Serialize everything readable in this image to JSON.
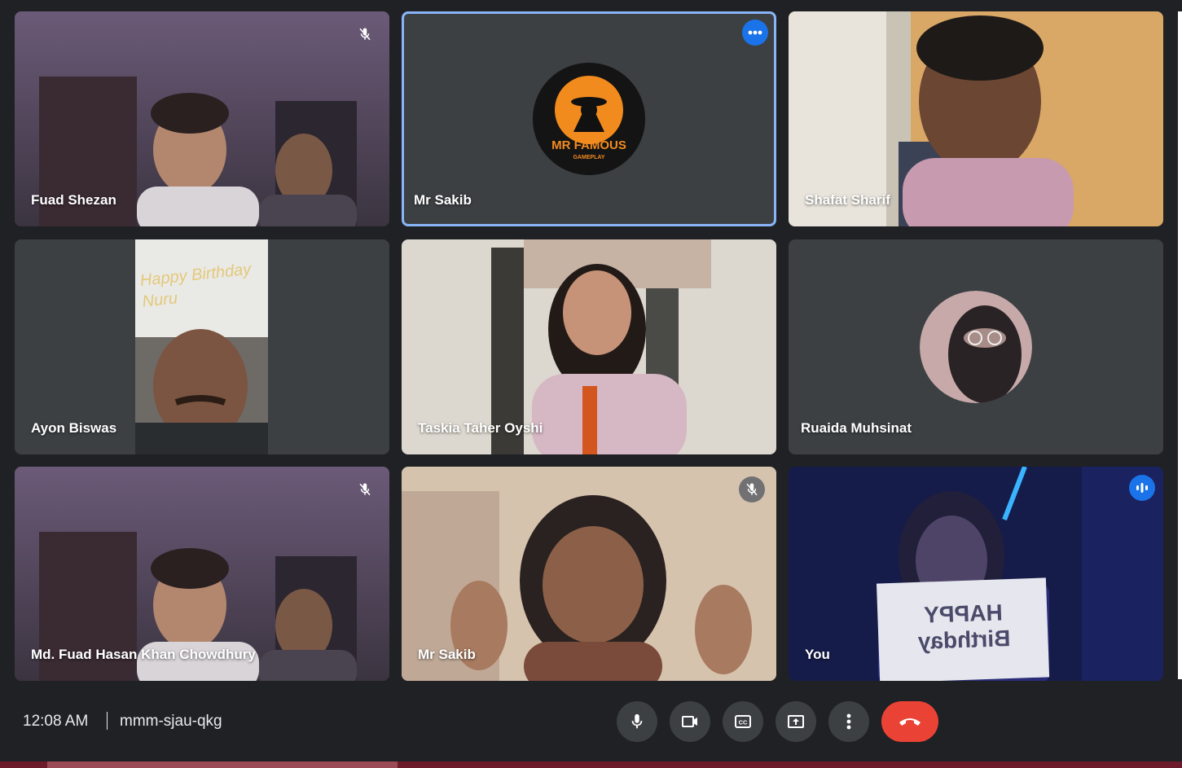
{
  "participants": [
    {
      "name": "Fuad Shezan",
      "muted": true
    },
    {
      "name": "Mr Sakib",
      "avatar_text": "MR FAMOUS",
      "avatar_subtext": "GAMEPLAY",
      "more_options": true
    },
    {
      "name": "Shafat Sharif"
    },
    {
      "name": "Ayon Biswas",
      "sign_text": "Happy Birthday Nuru"
    },
    {
      "name": "Taskia Taher Oyshi"
    },
    {
      "name": "Ruaida Muhsinat"
    },
    {
      "name": "Md. Fuad Hasan Khan Chowdhury",
      "muted": true
    },
    {
      "name": "Mr Sakib",
      "muted": true
    },
    {
      "name": "You",
      "speaking": true,
      "sign_text": "HAPPY Birthday"
    }
  ],
  "meeting": {
    "time": "12:08 AM",
    "code": "mmm-sjau-qkg"
  },
  "controls": [
    "mic-icon",
    "camera-icon",
    "captions-icon",
    "present-icon",
    "more-options-icon",
    "end-call-icon"
  ],
  "colors": {
    "background": "#202124",
    "tile": "#3c4043",
    "active_outline": "#8ab4f8",
    "end_call": "#ea4335",
    "accent": "#1a73e8"
  }
}
